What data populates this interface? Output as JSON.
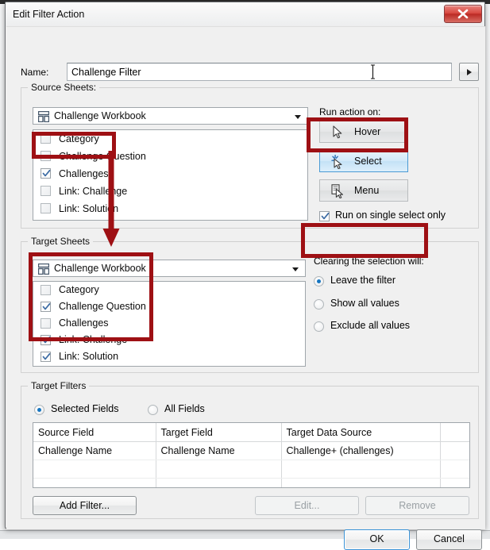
{
  "window": {
    "title": "Edit Filter Action",
    "close_icon": "close-x-icon"
  },
  "name_row": {
    "label": "Name:",
    "value": "Challenge Filter",
    "placeholder": "",
    "dropdown_icon": "triangle-right-icon"
  },
  "source_sheets": {
    "title": "Source Sheets:",
    "workbook": {
      "label": "Challenge Workbook",
      "icon": "workbook-dashboard-icon",
      "arrow_icon": "chevron-down-icon"
    },
    "items": [
      {
        "label": "Category",
        "checked": false
      },
      {
        "label": "Challenge Question",
        "checked": false
      },
      {
        "label": "Challenges",
        "checked": true
      },
      {
        "label": "Link: Challenge",
        "checked": false
      },
      {
        "label": "Link: Solution",
        "checked": false
      }
    ]
  },
  "run_action": {
    "label": "Run action on:",
    "buttons": [
      {
        "label": "Hover",
        "icon": "cursor-arrow-icon",
        "selected": false
      },
      {
        "label": "Select",
        "icon": "cursor-click-icon",
        "selected": true
      },
      {
        "label": "Menu",
        "icon": "cursor-menu-icon",
        "selected": false
      }
    ],
    "single_select": {
      "label": "Run on single select only",
      "checked": true
    }
  },
  "target_sheets": {
    "title": "Target Sheets",
    "workbook": {
      "label": "Challenge Workbook",
      "icon": "workbook-dashboard-icon",
      "arrow_icon": "chevron-down-icon"
    },
    "items": [
      {
        "label": "Category",
        "checked": false
      },
      {
        "label": "Challenge Question",
        "checked": true
      },
      {
        "label": "Challenges",
        "checked": false
      },
      {
        "label": "Link: Challenge",
        "checked": true
      },
      {
        "label": "Link: Solution",
        "checked": true
      }
    ]
  },
  "clearing_selection": {
    "label": "Clearing the selection will:",
    "options": [
      {
        "label": "Leave the filter",
        "selected": true
      },
      {
        "label": "Show all values",
        "selected": false
      },
      {
        "label": "Exclude all values",
        "selected": false
      }
    ]
  },
  "target_filters": {
    "title": "Target Filters",
    "scope_options": [
      {
        "label": "Selected Fields",
        "selected": true
      },
      {
        "label": "All Fields",
        "selected": false
      }
    ],
    "table": {
      "columns": [
        "Source Field",
        "Target Field",
        "Target Data Source",
        ""
      ],
      "rows": [
        [
          "Challenge Name",
          "Challenge Name",
          "Challenge+ (challenges)",
          ""
        ],
        [
          "",
          "",
          "",
          ""
        ],
        [
          "",
          "",
          "",
          ""
        ]
      ]
    },
    "buttons": {
      "add_filter": "Add Filter...",
      "edit": "Edit...",
      "remove": "Remove"
    }
  },
  "footer": {
    "ok": "OK",
    "cancel": "Cancel"
  },
  "annotations": {
    "accent_color": "#9E1014",
    "boxes": [
      "source-challenges-row",
      "select-action-button",
      "target-sheets-list",
      "clearing-leave-the-filter"
    ],
    "arrow": "down-arrow-source-to-target"
  }
}
